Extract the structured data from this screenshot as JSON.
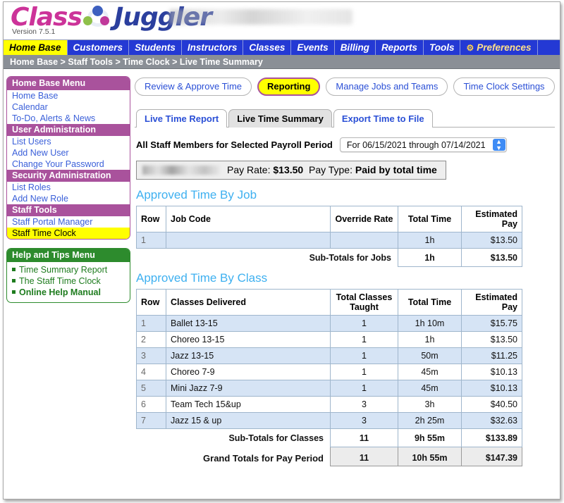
{
  "brand": {
    "name_part1": "Class",
    "name_part2": "Juggler",
    "version": "Version 7.5.1"
  },
  "navbar": {
    "items": [
      {
        "label": "Home Base",
        "active": true
      },
      {
        "label": "Customers",
        "active": false
      },
      {
        "label": "Students",
        "active": false
      },
      {
        "label": "Instructors",
        "active": false
      },
      {
        "label": "Classes",
        "active": false
      },
      {
        "label": "Events",
        "active": false
      },
      {
        "label": "Billing",
        "active": false
      },
      {
        "label": "Reports",
        "active": false
      },
      {
        "label": "Tools",
        "active": false
      },
      {
        "label": "Preferences",
        "active": false,
        "icon": "gear-icon"
      }
    ]
  },
  "breadcrumb": "Home Base > Staff Tools > Time Clock > Live Time Summary",
  "sidebar": {
    "home_menu": {
      "header": "Home Base Menu",
      "links": [
        "Home Base",
        "Calendar",
        "To-Do, Alerts & News"
      ],
      "groups": [
        {
          "header": "User Administration",
          "links": [
            "List Users",
            "Add New User",
            "Change Your Password"
          ]
        },
        {
          "header": "Security Administration",
          "links": [
            "List Roles",
            "Add New Role"
          ]
        },
        {
          "header": "Staff Tools",
          "links": [
            "Staff Portal Manager",
            "Staff Time Clock"
          ],
          "highlighted": "Staff Time Clock"
        }
      ]
    },
    "help_menu": {
      "header": "Help and Tips Menu",
      "links": [
        {
          "label": "Time Summary Report",
          "bold": false
        },
        {
          "label": "The Staff Time Clock",
          "bold": false
        },
        {
          "label": "Online Help Manual",
          "bold": true
        }
      ]
    }
  },
  "main": {
    "pills": [
      {
        "label": "Review & Approve Time",
        "selected": false
      },
      {
        "label": "Reporting",
        "selected": true
      },
      {
        "label": "Manage Jobs and Teams",
        "selected": false
      },
      {
        "label": "Time Clock Settings",
        "selected": false
      }
    ],
    "tabs": [
      {
        "label": "Live Time Report",
        "active": false
      },
      {
        "label": "Live Time Summary",
        "active": true
      },
      {
        "label": "Export Time to File",
        "active": false
      }
    ],
    "period": {
      "label": "All Staff Members for Selected Payroll Period",
      "selected_option": "For 06/15/2021 through 07/14/2021"
    },
    "pay_info": {
      "staff_name": "",
      "pay_rate_label": "Pay Rate:",
      "pay_rate_value": "$13.50",
      "pay_type_label": "Pay Type:",
      "pay_type_value": "Paid by total time"
    },
    "job_section": {
      "title": "Approved Time By Job",
      "headers": [
        "Row",
        "Job Code",
        "Override Rate",
        "Total Time",
        "Estimated Pay"
      ],
      "rows": [
        {
          "row": "1",
          "job_code": "",
          "override_rate": "",
          "total_time": "1h",
          "estimated_pay": "$13.50"
        }
      ],
      "subtotal": {
        "label": "Sub-Totals for Jobs",
        "total_time": "1h",
        "estimated_pay": "$13.50"
      }
    },
    "class_section": {
      "title": "Approved Time By Class",
      "headers": [
        "Row",
        "Classes Delivered",
        "Total Classes Taught",
        "Total Time",
        "Estimated Pay"
      ],
      "rows": [
        {
          "row": "1",
          "name": "Ballet 13-15",
          "classes": "1",
          "total_time": "1h 10m",
          "estimated_pay": "$15.75"
        },
        {
          "row": "2",
          "name": "Choreo 13-15",
          "classes": "1",
          "total_time": "1h",
          "estimated_pay": "$13.50"
        },
        {
          "row": "3",
          "name": "Jazz 13-15",
          "classes": "1",
          "total_time": "50m",
          "estimated_pay": "$11.25"
        },
        {
          "row": "4",
          "name": "Choreo 7-9",
          "classes": "1",
          "total_time": "45m",
          "estimated_pay": "$10.13"
        },
        {
          "row": "5",
          "name": "Mini Jazz 7-9",
          "classes": "1",
          "total_time": "45m",
          "estimated_pay": "$10.13"
        },
        {
          "row": "6",
          "name": "Team Tech 15&up",
          "classes": "3",
          "total_time": "3h",
          "estimated_pay": "$40.50"
        },
        {
          "row": "7",
          "name": "Jazz 15 & up",
          "classes": "3",
          "total_time": "2h 25m",
          "estimated_pay": "$32.63"
        }
      ],
      "subtotal": {
        "label": "Sub-Totals for Classes",
        "classes": "11",
        "total_time": "9h 55m",
        "estimated_pay": "$133.89"
      },
      "grand_total": {
        "label": "Grand Totals for Pay Period",
        "classes": "11",
        "total_time": "10h 55m",
        "estimated_pay": "$147.39"
      }
    }
  },
  "colors": {
    "nav_blue": "#2439d4",
    "nav_active_yellow": "#ffff00",
    "breadcrumb_gray": "#8a8f96",
    "menu_purple": "#a9529c",
    "help_green": "#2d8b2d",
    "section_title_blue": "#3eb0f0",
    "table_row_alt": "#d6e4f5",
    "link_blue": "#3a5fd9"
  }
}
